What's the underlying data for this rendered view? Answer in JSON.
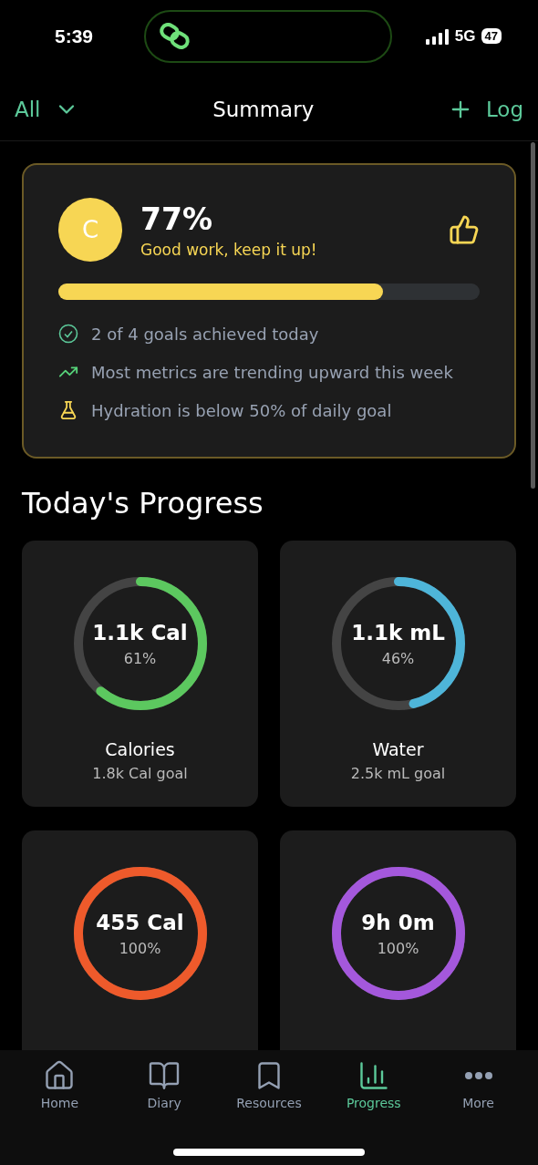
{
  "status_bar": {
    "time": "5:39",
    "network": "5G",
    "battery": "47"
  },
  "header": {
    "filter": "All",
    "title": "Summary",
    "action": "Log"
  },
  "summary": {
    "avatar": "C",
    "score": "77%",
    "message": "Good work, keep it up!",
    "level": 0.77,
    "insights": [
      {
        "kind": "check",
        "text": "2 of 4 goals achieved today"
      },
      {
        "kind": "trend",
        "text": "Most metrics are trending upward this week"
      },
      {
        "kind": "flask",
        "text": "Hydration is below 50% of daily goal"
      }
    ]
  },
  "progress": {
    "title": "Today's Progress",
    "metrics": [
      {
        "value": "1.1k Cal",
        "percent": "61%",
        "color": "#5cc85f",
        "name": "Calories",
        "goal": "1.8k Cal goal"
      },
      {
        "value": "1.1k mL",
        "percent": "46%",
        "color": "#4eb5d9",
        "name": "Water",
        "goal": "2.5k mL goal"
      },
      {
        "value": "455 Cal",
        "percent": "100%",
        "color": "#ee5a2b"
      },
      {
        "value": "9h 0m",
        "percent": "100%",
        "color": "#a458dc"
      }
    ]
  },
  "tabs": [
    {
      "kind": "home",
      "label": "Home",
      "selected": false
    },
    {
      "kind": "diary",
      "label": "Diary",
      "selected": false
    },
    {
      "kind": "resources",
      "label": "Resources",
      "selected": false
    },
    {
      "kind": "progress",
      "label": "Progress",
      "selected": true
    },
    {
      "kind": "more",
      "label": "More",
      "selected": false
    }
  ]
}
